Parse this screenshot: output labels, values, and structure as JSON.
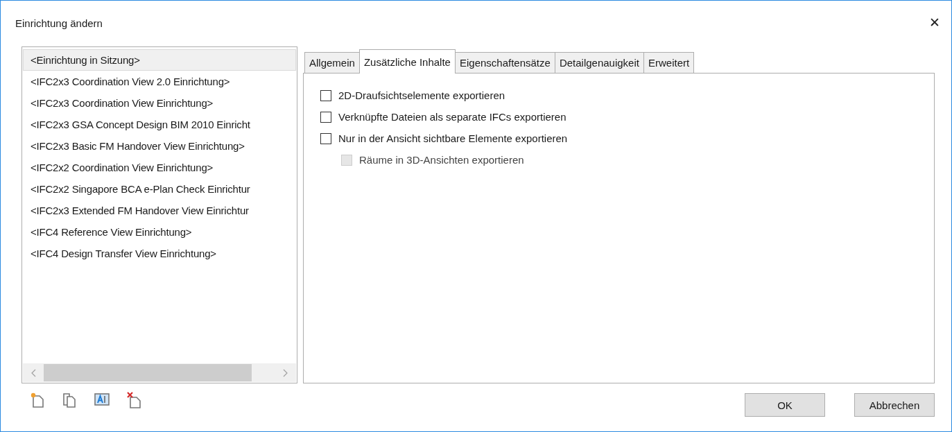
{
  "window": {
    "title": "Einrichtung ändern",
    "close": "✕"
  },
  "setups": [
    {
      "label": "<Einrichtung in Sitzung>",
      "selected": true
    },
    {
      "label": "<IFC2x3 Coordination View 2.0 Einrichtung>",
      "selected": false
    },
    {
      "label": "<IFC2x3 Coordination View Einrichtung>",
      "selected": false
    },
    {
      "label": "<IFC2x3 GSA Concept Design BIM 2010 Einricht",
      "selected": false
    },
    {
      "label": "<IFC2x3 Basic FM Handover View Einrichtung>",
      "selected": false
    },
    {
      "label": "<IFC2x2 Coordination View Einrichtung>",
      "selected": false
    },
    {
      "label": "<IFC2x2 Singapore BCA e-Plan Check Einrichtur",
      "selected": false
    },
    {
      "label": "<IFC2x3 Extended FM Handover View Einrichtur",
      "selected": false
    },
    {
      "label": "<IFC4 Reference View Einrichtung>",
      "selected": false
    },
    {
      "label": "<IFC4 Design Transfer View Einrichtung>",
      "selected": false
    }
  ],
  "tabs": [
    {
      "label": "Allgemein",
      "selected": false
    },
    {
      "label": "Zusätzliche Inhalte",
      "selected": true
    },
    {
      "label": "Eigenschaftensätze",
      "selected": false
    },
    {
      "label": "Detailgenauigkeit",
      "selected": false
    },
    {
      "label": "Erweitert",
      "selected": false
    }
  ],
  "options": [
    {
      "label": "2D-Draufsichtselemente exportieren",
      "checked": false,
      "disabled": false
    },
    {
      "label": "Verknüpfte Dateien als separate IFCs exportieren",
      "checked": false,
      "disabled": false
    },
    {
      "label": "Nur in der Ansicht sichtbare Elemente exportieren",
      "checked": false,
      "disabled": false,
      "children": [
        {
          "label": "Räume in 3D-Ansichten exportieren",
          "checked": false,
          "disabled": true
        }
      ]
    }
  ],
  "buttons": [
    "OK",
    "Abbrechen"
  ]
}
